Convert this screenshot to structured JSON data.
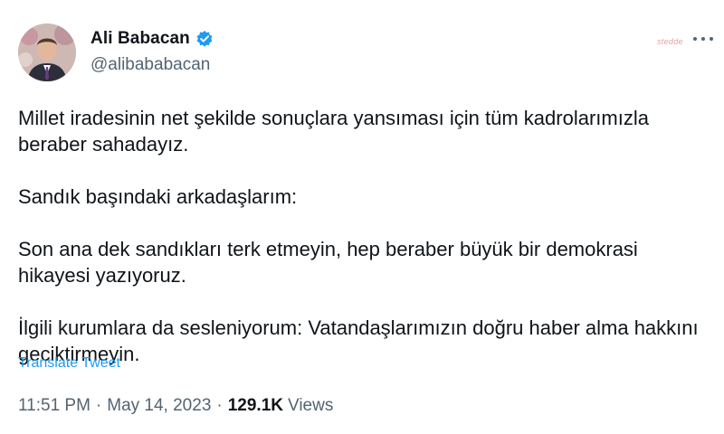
{
  "author": {
    "display_name": "Ali Babacan",
    "handle": "@alibababacan",
    "verified": true,
    "avatar_icon": "profile-photo"
  },
  "watermark": "stedde",
  "more_icon": "ellipsis-icon",
  "tweet": {
    "paragraphs": [
      "Millet iradesinin net şekilde sonuçlara yansıması için tüm kadrolarımızla beraber sahadayız.",
      "Sandık başındaki arkadaşlarım:",
      "Son ana dek sandıkları terk etmeyin, hep beraber büyük bir demokrasi hikayesi yazıyoruz.",
      "İlgili kurumlara da sesleniyorum: Vatandaşlarımızın doğru haber alma hakkını geciktirmeyin."
    ],
    "translate_label": "Translate Tweet"
  },
  "meta": {
    "time": "11:51 PM",
    "separator": "·",
    "date": "May 14, 2023",
    "views_count": "129.1K",
    "views_label": "Views"
  },
  "colors": {
    "text_primary": "#0f1419",
    "text_secondary": "#536471",
    "link": "#1d9bf0",
    "verified": "#1d9bf0"
  }
}
